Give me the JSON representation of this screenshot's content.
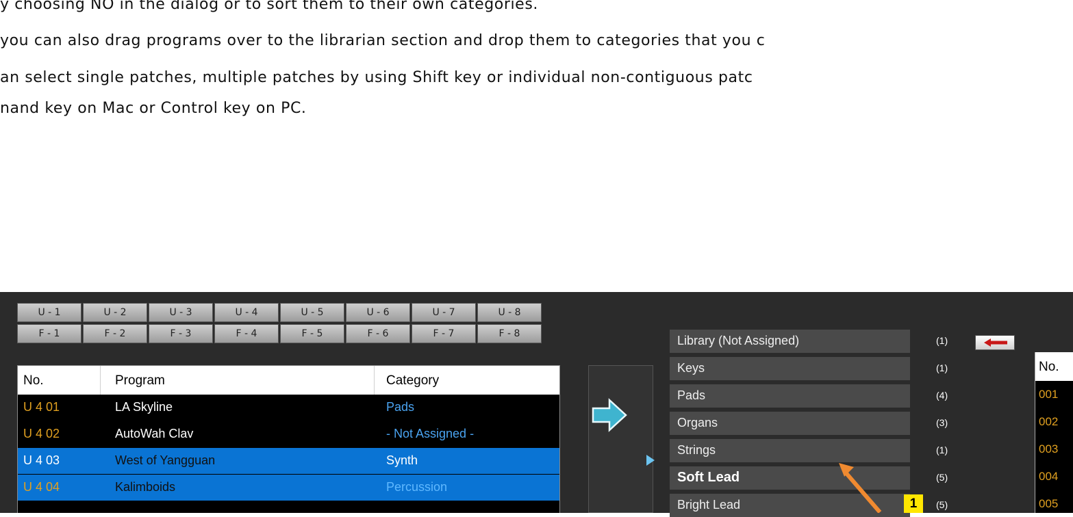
{
  "doc": {
    "lines": [
      "y choosing NO in the dialog or to sort them to their own categories.",
      "you can also drag programs over to the librarian section and drop them to categories that you c",
      "an select single patches, multiple patches by using Shift key or individual non-contiguous patc",
      "nand key on Mac or Control key on PC."
    ]
  },
  "app": {
    "u_buttons": [
      "U - 1",
      "U - 2",
      "U - 3",
      "U - 4",
      "U - 5",
      "U - 6",
      "U - 7",
      "U - 8"
    ],
    "f_buttons": [
      "F - 1",
      "F - 2",
      "F - 3",
      "F - 4",
      "F - 5",
      "F - 6",
      "F - 7",
      "F - 8"
    ],
    "program_table": {
      "headers": {
        "no": "No.",
        "program": "Program",
        "category": "Category"
      },
      "rows": [
        {
          "no": "U 4 01",
          "program": "LA Skyline",
          "category": "Pads"
        },
        {
          "no": "U 4 02",
          "program": "AutoWah Clav",
          "category": "- Not Assigned -"
        },
        {
          "no": "U 4 03",
          "program": "West of Yangguan",
          "category": "Synth"
        },
        {
          "no": "U 4 04",
          "program": "Kalimboids",
          "category": "Percussion"
        }
      ]
    },
    "categories": [
      {
        "label": "Library (Not Assigned)",
        "count": "(1)"
      },
      {
        "label": "Keys",
        "count": "(1)"
      },
      {
        "label": "Pads",
        "count": "(4)"
      },
      {
        "label": "Organs",
        "count": "(3)"
      },
      {
        "label": "Strings",
        "count": "(1)"
      },
      {
        "label": "Soft Lead",
        "count": "(5)"
      },
      {
        "label": "Bright Lead",
        "count": "(5)"
      }
    ],
    "badge": "1",
    "library_table": {
      "header": "No.",
      "rows": [
        "001",
        "002",
        "003",
        "004",
        "005"
      ]
    },
    "colors": {
      "background": "#2b2b2b",
      "selected_row": "#0a74d4",
      "number_text": "#e0a020",
      "category_text": "#4aa3f0",
      "arrow_fill": "#3fb4cf",
      "badge": "#ffe600",
      "annotation_arrow": "#f08a30"
    },
    "icons": {
      "transfer": "right-arrow-icon",
      "back": "left-arrow-icon",
      "current_category": "play-triangle-icon"
    }
  }
}
